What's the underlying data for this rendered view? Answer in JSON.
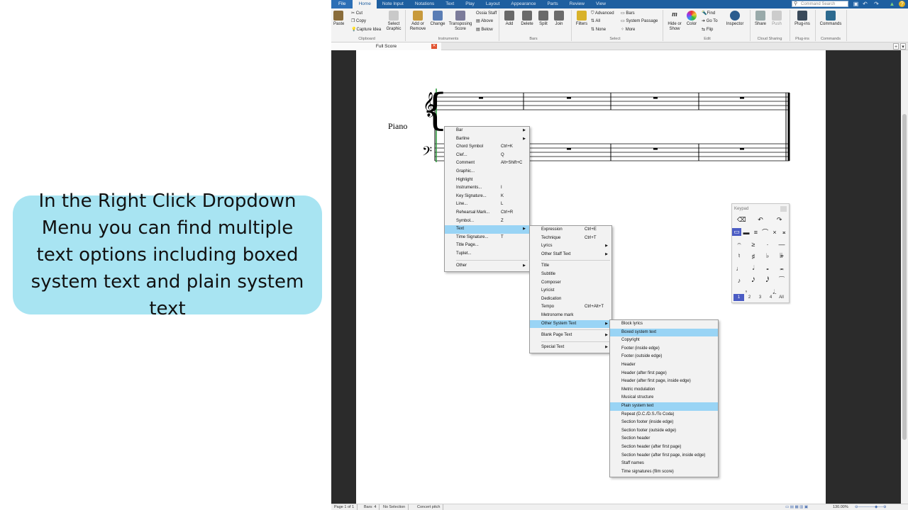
{
  "callout": {
    "text": "In the Right Click Dropdown Menu you can find multiple text options including boxed system text and plain system text"
  },
  "menubar": {
    "tabs": [
      "File",
      "Home",
      "Note Input",
      "Notations",
      "Text",
      "Play",
      "Layout",
      "Appearance",
      "Parts",
      "Review",
      "View"
    ],
    "active": "Home",
    "search_placeholder": "Command Search"
  },
  "ribbon": {
    "clipboard": {
      "paste": "Paste",
      "cut": "Cut",
      "copy": "Copy",
      "capture": "Capture Idea",
      "select_graphic": "Select Graphic",
      "label": "Clipboard"
    },
    "instruments": {
      "add_remove": "Add or Remove",
      "change": "Change",
      "transposing": "Transposing Score",
      "ossia": "Ossia Staff",
      "above": "Above",
      "below": "Below",
      "label": "Instruments"
    },
    "bars": {
      "add": "Add",
      "delete": "Delete",
      "split": "Split",
      "join": "Join",
      "label": "Bars"
    },
    "select": {
      "filters": "Filters",
      "advanced": "Advanced",
      "all": "All",
      "none": "None",
      "bars": "Bars",
      "system_passage": "System Passage",
      "more": "More",
      "label": "Select"
    },
    "edit": {
      "hide_show": "Hide or Show",
      "color": "Color",
      "find": "Find",
      "goto": "Go To",
      "flip": "Flip",
      "inspector": "Inspector",
      "label": "Edit"
    },
    "cloud": {
      "share": "Share",
      "push": "Push",
      "label": "Cloud Sharing"
    },
    "plugins": {
      "plugins": "Plug-ins",
      "label": "Plug-ins"
    },
    "commands": {
      "commands": "Commands",
      "label": "Commands"
    }
  },
  "doc_tab": {
    "title": "Full Score"
  },
  "score": {
    "instrument": "Piano"
  },
  "context_menu": [
    {
      "label": "Bar",
      "shortcut": "",
      "sub": true
    },
    {
      "label": "Barline",
      "shortcut": "",
      "sub": true
    },
    {
      "label": "Chord Symbol",
      "shortcut": "Ctrl+K"
    },
    {
      "label": "Clef...",
      "shortcut": "Q"
    },
    {
      "label": "Comment",
      "shortcut": "Alt+Shift+C"
    },
    {
      "label": "Graphic...",
      "shortcut": ""
    },
    {
      "label": "Highlight",
      "shortcut": ""
    },
    {
      "label": "Instruments...",
      "shortcut": "I"
    },
    {
      "label": "Key Signature...",
      "shortcut": "K"
    },
    {
      "label": "Line...",
      "shortcut": "L"
    },
    {
      "label": "Rehearsal Mark...",
      "shortcut": "Ctrl+R"
    },
    {
      "label": "Symbol...",
      "shortcut": "Z"
    },
    {
      "label": "Text",
      "shortcut": "",
      "sub": true,
      "hl": true
    },
    {
      "label": "Time Signature...",
      "shortcut": "T"
    },
    {
      "label": "Title Page...",
      "shortcut": ""
    },
    {
      "label": "Tuplet...",
      "shortcut": ""
    },
    {
      "sep": true
    },
    {
      "label": "Other",
      "shortcut": "",
      "sub": true
    }
  ],
  "text_menu": [
    {
      "label": "Expression",
      "shortcut": "Ctrl+E"
    },
    {
      "label": "Technique",
      "shortcut": "Ctrl+T"
    },
    {
      "label": "Lyrics",
      "shortcut": "",
      "sub": true
    },
    {
      "label": "Other Staff Text",
      "shortcut": "",
      "sub": true
    },
    {
      "sep": true
    },
    {
      "label": "Title",
      "shortcut": ""
    },
    {
      "label": "Subtitle",
      "shortcut": ""
    },
    {
      "label": "Composer",
      "shortcut": ""
    },
    {
      "label": "Lyricist",
      "shortcut": ""
    },
    {
      "label": "Dedication",
      "shortcut": ""
    },
    {
      "label": "Tempo",
      "shortcut": "Ctrl+Alt+T"
    },
    {
      "label": "Metronome mark",
      "shortcut": ""
    },
    {
      "label": "Other System Text",
      "shortcut": "",
      "sub": true,
      "hl": true
    },
    {
      "sep": true
    },
    {
      "label": "Blank Page Text",
      "shortcut": "",
      "sub": true
    },
    {
      "sep": true
    },
    {
      "label": "Special Text",
      "shortcut": "",
      "sub": true
    }
  ],
  "system_text_menu": [
    {
      "label": "Block lyrics"
    },
    {
      "label": "Boxed system text",
      "hl": true
    },
    {
      "label": "Copyright"
    },
    {
      "label": "Footer (inside edge)"
    },
    {
      "label": "Footer (outside edge)"
    },
    {
      "label": "Header"
    },
    {
      "label": "Header (after first page)"
    },
    {
      "label": "Header (after first page, inside edge)"
    },
    {
      "label": "Metric modulation"
    },
    {
      "label": "Musical structure"
    },
    {
      "label": "Plain system text",
      "hl": true
    },
    {
      "label": "Repeat (D.C./D.S./To Coda)"
    },
    {
      "label": "Section footer (inside edge)"
    },
    {
      "label": "Section footer (outside edge)"
    },
    {
      "label": "Section header"
    },
    {
      "label": "Section header (after first page)"
    },
    {
      "label": "Section header (after first page, inside edge)"
    },
    {
      "label": "Staff names"
    },
    {
      "label": "Time signatures (film score)"
    }
  ],
  "keypad": {
    "title": "Keypad",
    "layouts": [
      "1",
      "2",
      "3",
      "4",
      "All"
    ],
    "rows": [
      [
        "⌫",
        "↶",
        "↷"
      ],
      [
        "▭",
        "▬",
        "≡",
        "⌒",
        "×",
        "𝄪"
      ],
      [
        "𝄐",
        "≥",
        "·",
        "—"
      ],
      [
        "♮",
        "♯",
        "♭",
        "𝄫"
      ],
      [
        "♩",
        "𝅗𝅥",
        "𝅝",
        "𝅜"
      ],
      [
        "♪",
        "𝅘𝅥𝅯",
        "𝅘𝅥𝅰",
        "⁀"
      ],
      [
        "𝄾",
        "𝅗𝅥."
      ]
    ]
  },
  "status": {
    "page": "Page 1 of 1",
    "bars": "Bars: 4",
    "selection": "No Selection",
    "pitch": "Concert pitch",
    "zoom": "130.00%"
  }
}
